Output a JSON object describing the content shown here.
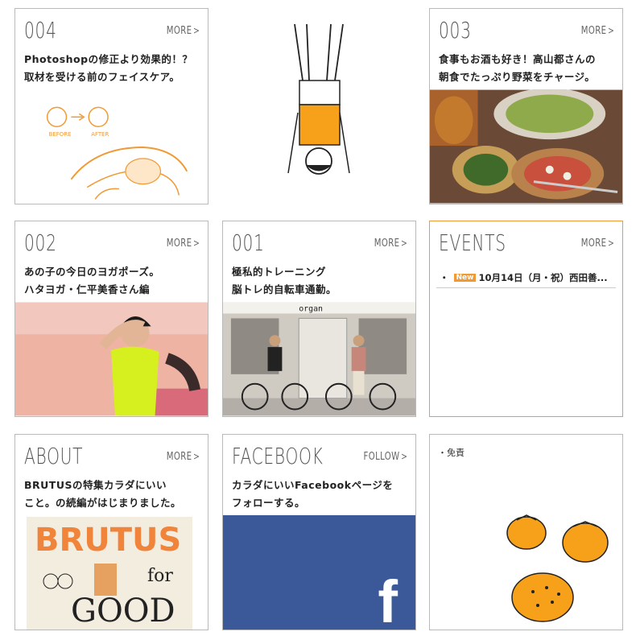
{
  "cards": {
    "c004": {
      "num": "004",
      "more": "MORE",
      "line1": "Photoshopの修正より効果的！？",
      "line2": "取材を受ける前のフェイスケア。",
      "sketch_before": "BEFORE",
      "sketch_after": "AFTER"
    },
    "c003": {
      "num": "003",
      "more": "MORE",
      "line1": "食事もお酒も好き！高山都さんの",
      "line2": "朝食でたっぷり野菜をチャージ。"
    },
    "c002": {
      "num": "002",
      "more": "MORE",
      "line1": "あの子の今日のヨガポーズ。",
      "line2": "ハタヨガ・仁平美香さん編"
    },
    "c001": {
      "num": "001",
      "more": "MORE",
      "line1": "極私的トレーニング",
      "line2": "脳トレ的自転車通勤。",
      "shop_sign": "organ"
    },
    "events": {
      "title": "EVENTS",
      "more": "MORE",
      "bullet": "・",
      "badge": "New",
      "item": "10月14日（月・祝）西田善..."
    },
    "about": {
      "title": "ABOUT",
      "more": "MORE",
      "line1": "BRUTUSの特集カラダにいい",
      "line2": "こと。の続編がはじまりました。",
      "magazine_title": "BRUTUS",
      "magazine_for": "for",
      "magazine_good": "GOOD"
    },
    "facebook": {
      "title": "FACEBOOK",
      "more": "FOLLOW",
      "line1": "カラダにいいFacebookページを",
      "line2": "フォローする。",
      "fb_glyph": "f"
    },
    "disclaimer": {
      "label": "・免責"
    }
  },
  "colors": {
    "accent": "#f09a36",
    "facebook": "#3b5998",
    "border": "#b9b9b9"
  }
}
